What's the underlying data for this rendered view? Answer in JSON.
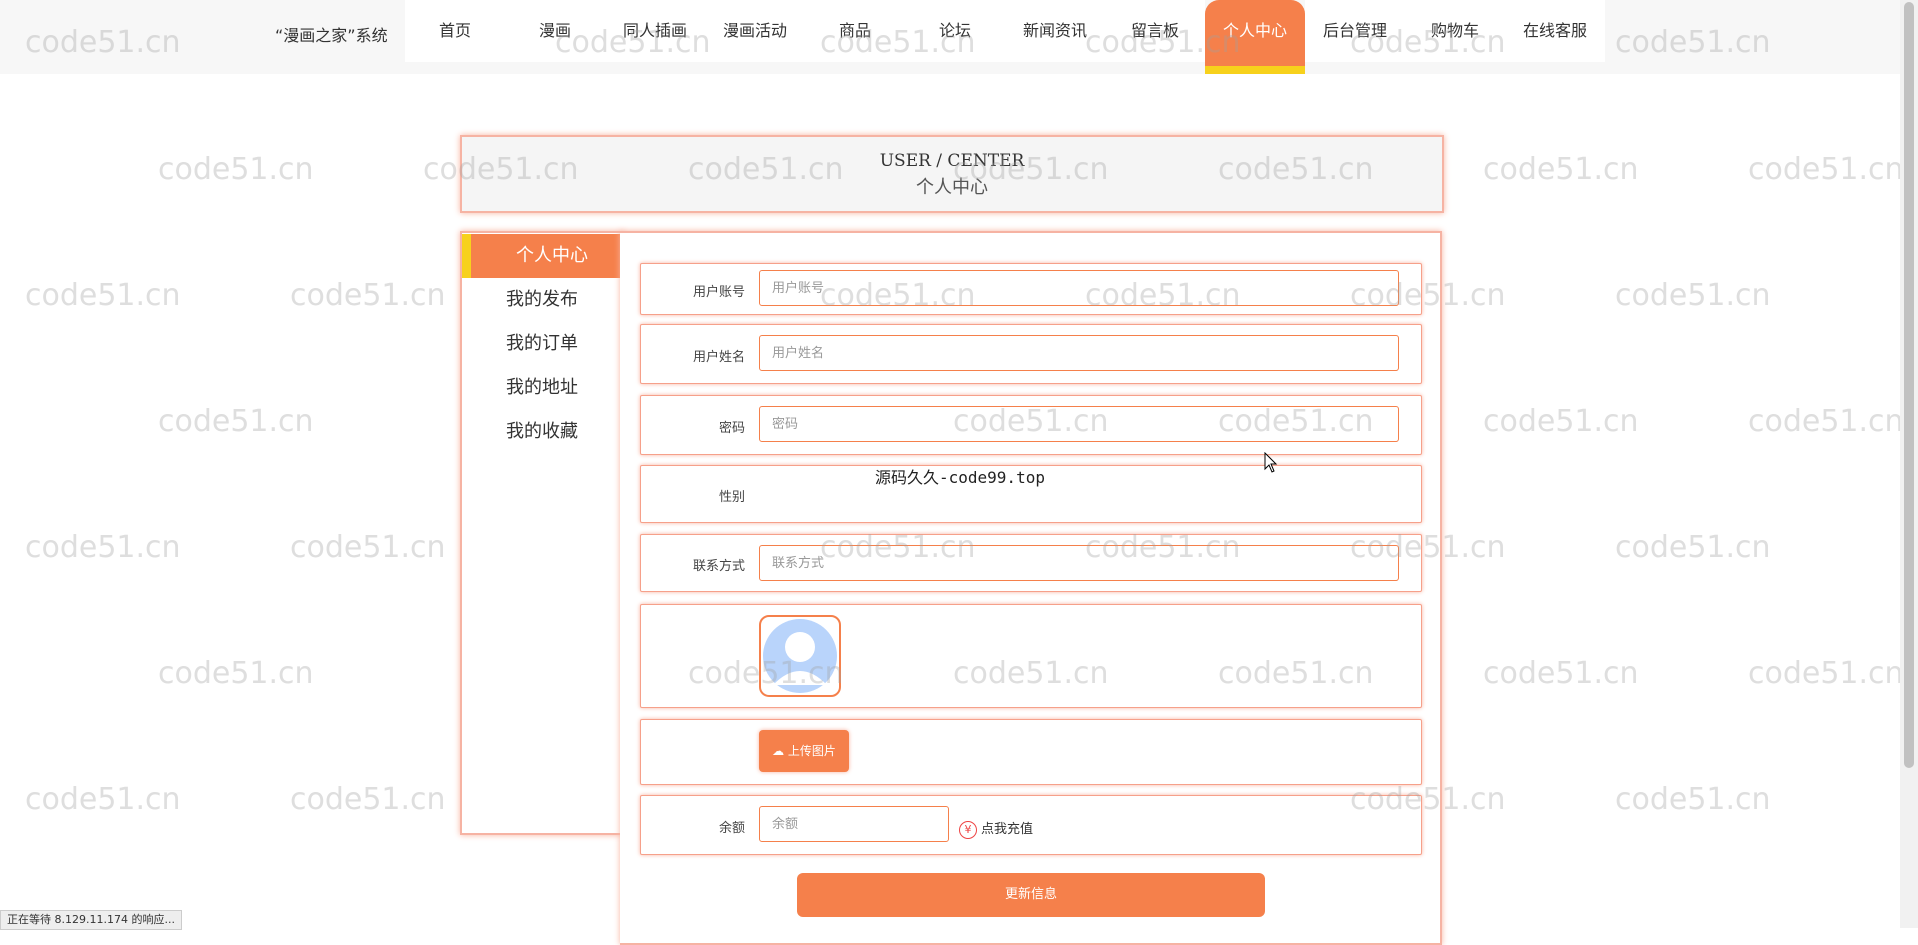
{
  "header": {
    "brand": "“漫画之家”系统",
    "nav": [
      "首页",
      "漫画",
      "同人插画",
      "漫画活动",
      "商品",
      "论坛",
      "新闻资讯",
      "留言板",
      "个人中心",
      "后台管理",
      "购物车",
      "在线客服"
    ],
    "active_nav": "个人中心"
  },
  "banner": {
    "en": "USER / CENTER",
    "cn": "个人中心"
  },
  "sidebar": {
    "items": [
      "个人中心",
      "我的发布",
      "我的订单",
      "我的地址",
      "我的收藏"
    ],
    "active": "个人中心"
  },
  "form": {
    "account": {
      "label": "用户账号",
      "placeholder": "用户账号"
    },
    "name": {
      "label": "用户姓名",
      "placeholder": "用户姓名"
    },
    "password": {
      "label": "密码",
      "placeholder": "密码"
    },
    "gender": {
      "label": "性别"
    },
    "contact": {
      "label": "联系方式",
      "placeholder": "联系方式"
    },
    "upload_label": "上传图片",
    "balance": {
      "label": "余额",
      "placeholder": "余额"
    },
    "recharge_label": "点我充值",
    "recharge_icon": "yen-circle-icon",
    "submit_label": "更新信息"
  },
  "overlay_text": "源码久久-code99.top",
  "watermark": "code51.cn",
  "status_bar": "正在等待 8.129.11.174 的响应...",
  "colors": {
    "accent": "#f5804b",
    "highlight": "#f7d11c",
    "border": "#f6b3a3"
  }
}
